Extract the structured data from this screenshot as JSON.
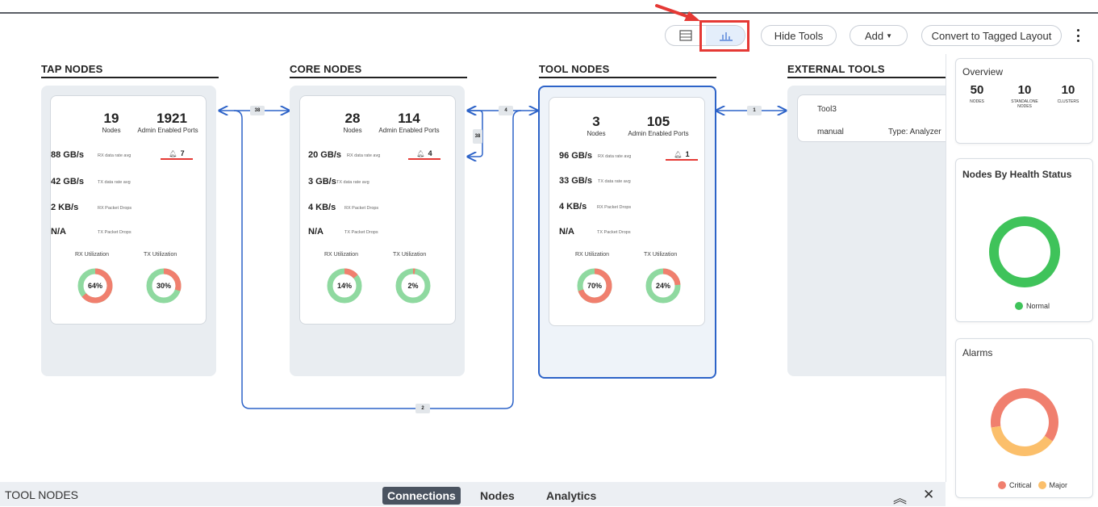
{
  "toolbar": {
    "hide_tools": "Hide Tools",
    "add": "Add",
    "convert": "Convert to Tagged Layout",
    "view_list_icon": "list-view-icon",
    "view_chart_icon": "chart-view-icon"
  },
  "columns": {
    "tap": {
      "title": "TAP NODES",
      "nodes": "19",
      "nodes_label": "Nodes",
      "ports": "1921",
      "ports_label": "Admin Enabled Ports",
      "rx": "88 GB/s",
      "rx_label": "RX data rate avg",
      "alarm_count": "7",
      "tx": "42 GB/s",
      "tx_label": "TX data rate avg",
      "rx_drops": "2 KB/s",
      "rx_drops_label": "RX Packet Drops",
      "tx_drops": "N/A",
      "tx_drops_label": "TX Packet Drops",
      "rx_util_label": "RX Utilization",
      "tx_util_label": "TX Utilization",
      "rx_util": 64,
      "rx_util_text": "64%",
      "tx_util": 30,
      "tx_util_text": "30%"
    },
    "core": {
      "title": "CORE NODES",
      "nodes": "28",
      "nodes_label": "Nodes",
      "ports": "114",
      "ports_label": "Admin Enabled Ports",
      "rx": "20 GB/s",
      "rx_label": "RX data rate avg",
      "alarm_count": "4",
      "tx": "3 GB/s",
      "tx_label": "TX data rate avg",
      "rx_drops": "4 KB/s",
      "rx_drops_label": "RX Packet Drops",
      "tx_drops": "N/A",
      "tx_drops_label": "TX Packet Drops",
      "rx_util_label": "RX Utilization",
      "tx_util_label": "TX Utilization",
      "rx_util": 14,
      "rx_util_text": "14%",
      "tx_util": 2,
      "tx_util_text": "2%"
    },
    "tool": {
      "title": "TOOL NODES",
      "nodes": "3",
      "nodes_label": "Nodes",
      "ports": "105",
      "ports_label": "Admin Enabled Ports",
      "rx": "96 GB/s",
      "rx_label": "RX data rate avg",
      "alarm_count": "1",
      "tx": "33 GB/s",
      "tx_label": "TX data rate avg",
      "rx_drops": "4 KB/s",
      "rx_drops_label": "RX Packet Drops",
      "tx_drops": "N/A",
      "tx_drops_label": "TX Packet Drops",
      "rx_util_label": "RX Utilization",
      "tx_util_label": "TX Utilization",
      "rx_util": 70,
      "rx_util_text": "70%",
      "tx_util": 24,
      "tx_util_text": "24%"
    },
    "external": {
      "title": "EXTERNAL TOOLS",
      "tool_name": "Tool3",
      "tool_mode": "manual",
      "tool_type": "Type: Analyzer"
    }
  },
  "links": {
    "tap_core": "38",
    "core_tool": "4",
    "core_self": "38",
    "tool_ext": "1",
    "tap_tool": "2"
  },
  "overview": {
    "title": "Overview",
    "nodes": "50",
    "nodes_label": "NODES",
    "standalone": "10",
    "standalone_label": "STANDALONE NODES",
    "clusters": "10",
    "clusters_label": "CLUSTERS"
  },
  "health": {
    "title": "Nodes By Health Status",
    "legend_normal": "Normal",
    "normal_pct": 100
  },
  "alarms": {
    "title": "Alarms",
    "legend_critical": "Critical",
    "legend_major": "Major",
    "critical_pct": 62,
    "major_pct": 38
  },
  "bottom": {
    "title": "TOOL NODES",
    "tabs": [
      "Connections",
      "Nodes",
      "Analytics"
    ],
    "active_tab": "Connections"
  },
  "colors": {
    "red": "#f07f6e",
    "green": "#8fd9a0",
    "health_green": "#3fc35a",
    "alarm_critical": "#f07f6e",
    "alarm_major": "#fbbf6b",
    "link_blue": "#2d63c8"
  }
}
